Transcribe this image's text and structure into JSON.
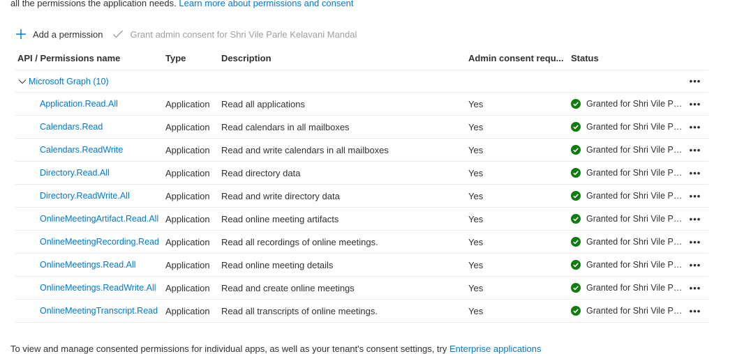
{
  "intro": {
    "text": "all the permissions the application needs.",
    "link": "Learn more about permissions and consent"
  },
  "toolbar": {
    "add_label": "Add a permission",
    "grant_label": "Grant admin consent for Shri Vile Parle Kelavani Mandal"
  },
  "columns": {
    "name": "API / Permissions name",
    "type": "Type",
    "description": "Description",
    "admin": "Admin consent requ...",
    "status": "Status"
  },
  "group": {
    "label": "Microsoft Graph (10)",
    "more": "•••"
  },
  "rows": [
    {
      "name": "Application.Read.All",
      "type": "Application",
      "description": "Read all applications",
      "admin": "Yes",
      "status": "Granted for Shri Vile Parle Kelavani Mandal",
      "more": "•••"
    },
    {
      "name": "Calendars.Read",
      "type": "Application",
      "description": "Read calendars in all mailboxes",
      "admin": "Yes",
      "status": "Granted for Shri Vile Parle Kelavani Mandal",
      "more": "•••"
    },
    {
      "name": "Calendars.ReadWrite",
      "type": "Application",
      "description": "Read and write calendars in all mailboxes",
      "admin": "Yes",
      "status": "Granted for Shri Vile Parle Kelavani Mandal",
      "more": "•••"
    },
    {
      "name": "Directory.Read.All",
      "type": "Application",
      "description": "Read directory data",
      "admin": "Yes",
      "status": "Granted for Shri Vile Parle Kelavani Mandal",
      "more": "•••"
    },
    {
      "name": "Directory.ReadWrite.All",
      "type": "Application",
      "description": "Read and write directory data",
      "admin": "Yes",
      "status": "Granted for Shri Vile Parle Kelavani Mandal",
      "more": "•••"
    },
    {
      "name": "OnlineMeetingArtifact.Read.All",
      "type": "Application",
      "description": "Read online meeting artifacts",
      "admin": "Yes",
      "status": "Granted for Shri Vile Parle Kelavani Mandal",
      "more": "•••"
    },
    {
      "name": "OnlineMeetingRecording.Read.All",
      "type": "Application",
      "description": "Read all recordings of online meetings.",
      "admin": "Yes",
      "status": "Granted for Shri Vile Parle Kelavani Mandal",
      "more": "•••"
    },
    {
      "name": "OnlineMeetings.Read.All",
      "type": "Application",
      "description": "Read online meeting details",
      "admin": "Yes",
      "status": "Granted for Shri Vile Parle Kelavani Mandal",
      "more": "•••"
    },
    {
      "name": "OnlineMeetings.ReadWrite.All",
      "type": "Application",
      "description": "Read and create online meetings",
      "admin": "Yes",
      "status": "Granted for Shri Vile Parle Kelavani Mandal",
      "more": "•••"
    },
    {
      "name": "OnlineMeetingTranscript.Read.All",
      "type": "Application",
      "description": "Read all transcripts of online meetings.",
      "admin": "Yes",
      "status": "Granted for Shri Vile Parle Kelavani Mandal",
      "more": "•••"
    }
  ],
  "footer": {
    "text": "To view and manage consented permissions for individual apps, as well as your tenant's consent settings, try",
    "link": "Enterprise applications"
  },
  "colors": {
    "link": "#0078d4",
    "success": "#107c10",
    "border": "#edebe9"
  }
}
